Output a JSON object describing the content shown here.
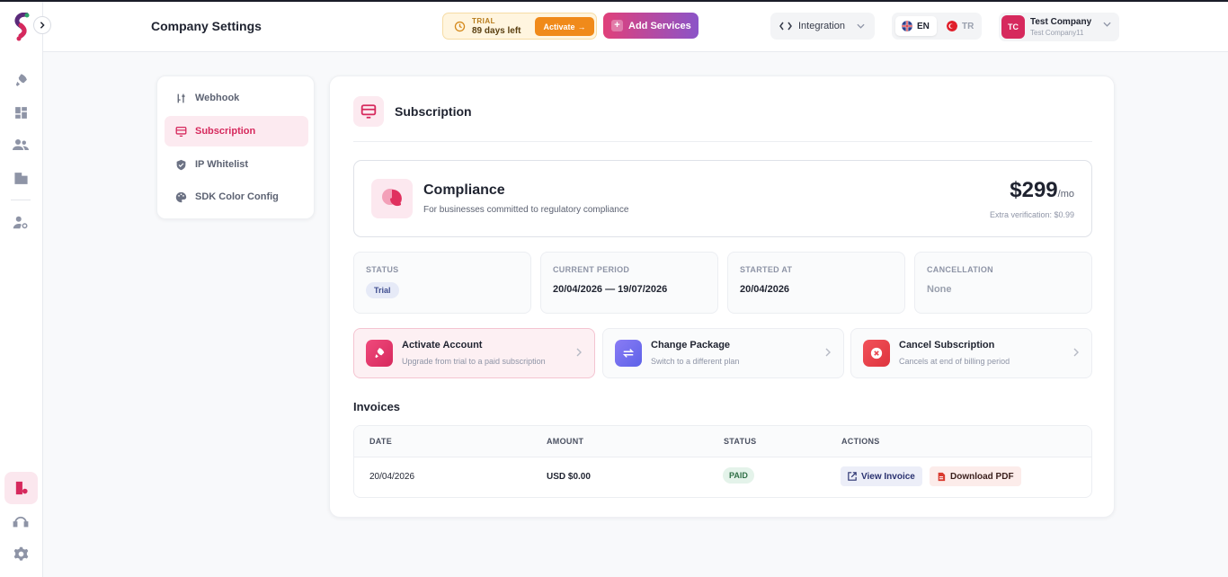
{
  "header": {
    "title": "Company Settings",
    "trial": {
      "label": "TRIAL",
      "days_left": "89 days left",
      "activate_label": "Activate"
    },
    "add_services_label": "Add Services",
    "integration_label": "Integration",
    "languages": [
      {
        "code": "EN",
        "active": true
      },
      {
        "code": "TR",
        "active": false
      }
    ],
    "company": {
      "initials": "TC",
      "name": "Test Company",
      "subtitle": "Test Company11"
    }
  },
  "rail": {
    "icons": [
      "rocket-icon",
      "dashboard-icon",
      "users-icon",
      "building-icon",
      "user-settings-icon"
    ],
    "bottom_icons": [
      "company-settings-icon",
      "support-icon",
      "gear-icon"
    ]
  },
  "settings_nav": {
    "items": [
      {
        "label": "Webhook",
        "icon": "webhook-icon",
        "active": false
      },
      {
        "label": "Subscription",
        "icon": "subscription-icon",
        "active": true
      },
      {
        "label": "IP Whitelist",
        "icon": "shield-icon",
        "active": false
      },
      {
        "label": "SDK Color Config",
        "icon": "palette-icon",
        "active": false
      }
    ]
  },
  "subscription": {
    "title": "Subscription",
    "plan": {
      "name": "Compliance",
      "description": "For businesses committed to regulatory compliance",
      "price": "$299",
      "period": "/mo",
      "extra": "Extra verification: $0.99"
    },
    "info": [
      {
        "label": "STATUS",
        "value": "Trial"
      },
      {
        "label": "CURRENT PERIOD",
        "value": "20/04/2026 — 19/07/2026"
      },
      {
        "label": "STARTED AT",
        "value": "20/04/2026"
      },
      {
        "label": "CANCELLATION",
        "value": "None"
      }
    ],
    "actions": [
      {
        "title": "Activate Account",
        "subtitle": "Upgrade from trial to a paid subscription",
        "icon": "rocket-icon"
      },
      {
        "title": "Change Package",
        "subtitle": "Switch to a different plan",
        "icon": "swap-icon"
      },
      {
        "title": "Cancel Subscription",
        "subtitle": "Cancels at end of billing period",
        "icon": "cancel-icon"
      }
    ],
    "colors": {
      "accent": "#d6295d",
      "activate": "#f08a1a",
      "change": "#7068ee",
      "cancel": "#e8414b"
    }
  },
  "invoices": {
    "title": "Invoices",
    "columns": [
      "DATE",
      "AMOUNT",
      "STATUS",
      "ACTIONS"
    ],
    "rows": [
      {
        "date": "20/04/2026",
        "amount": "USD $0.00",
        "status": "PAID",
        "view_label": "View Invoice",
        "pdf_label": "Download PDF"
      }
    ]
  }
}
